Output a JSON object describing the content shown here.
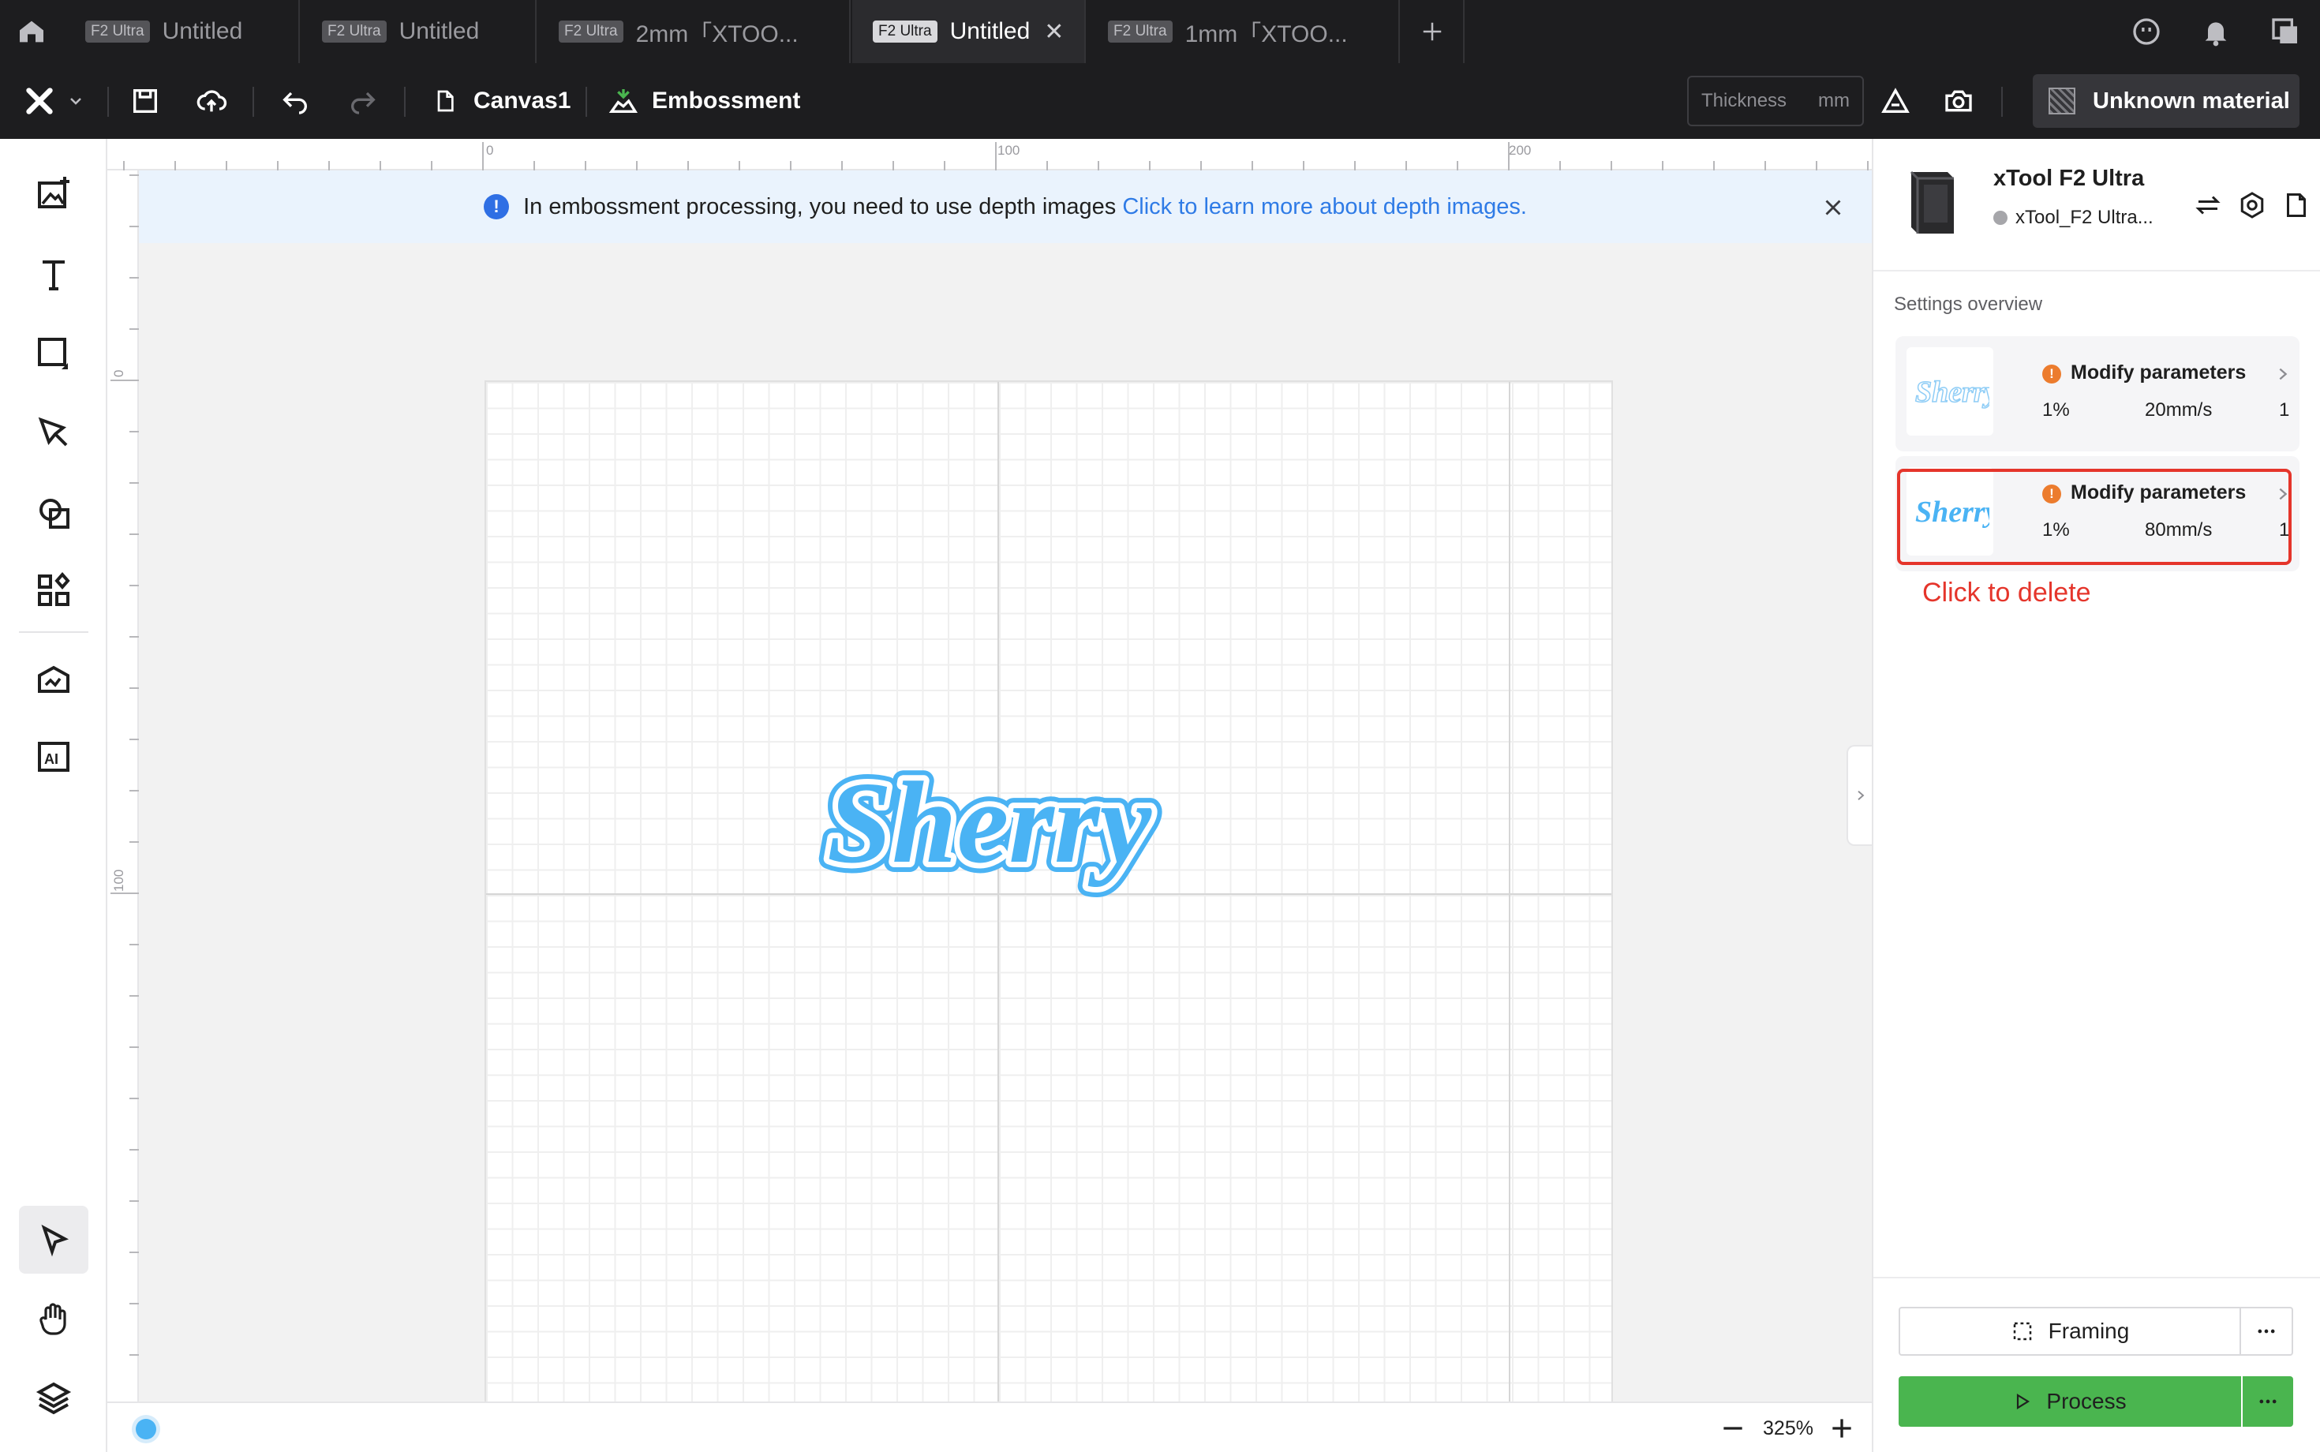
{
  "tabs": [
    {
      "badge": "F2 Ultra",
      "label": "Untitled",
      "active": false
    },
    {
      "badge": "F2 Ultra",
      "label": "Untitled",
      "active": false
    },
    {
      "badge": "F2 Ultra",
      "label": "2mm「XTOO...",
      "active": false
    },
    {
      "badge": "F2 Ultra",
      "label": "Untitled",
      "active": true
    },
    {
      "badge": "F2 Ultra",
      "label": "1mm「XTOO...",
      "active": false
    }
  ],
  "toolbar": {
    "canvas_label": "Canvas1",
    "mode_label": "Embossment",
    "thickness_placeholder": "Thickness",
    "thickness_unit": "mm",
    "material_label": "Unknown material"
  },
  "rulers": {
    "top_ticks": [
      "0",
      "100",
      "200"
    ],
    "left_ticks": [
      "0",
      "100"
    ]
  },
  "banner": {
    "message": "In embossment processing, you need to use depth images",
    "link": "Click to learn more about depth images."
  },
  "canvas": {
    "artwork_text": "Sherry"
  },
  "status": {
    "zoom": "325%"
  },
  "device": {
    "name": "xTool F2 Ultra",
    "connection": "xTool_F2 Ultra..."
  },
  "settings": {
    "title": "Settings overview",
    "cards": [
      {
        "thumb_text": "Sherry",
        "title": "Modify parameters",
        "power": "1%",
        "speed": "20mm/s",
        "passes": "1"
      },
      {
        "thumb_text": "Sherry",
        "title": "Modify parameters",
        "power": "1%",
        "speed": "80mm/s",
        "passes": "1"
      }
    ]
  },
  "annotation": "Click to delete",
  "actions": {
    "framing": "Framing",
    "process": "Process"
  },
  "colors": {
    "accent_blue": "#4ab3f4",
    "process_green": "#4ab54f",
    "annotation_red": "#e5352b",
    "warning_orange": "#ec7c2e"
  }
}
